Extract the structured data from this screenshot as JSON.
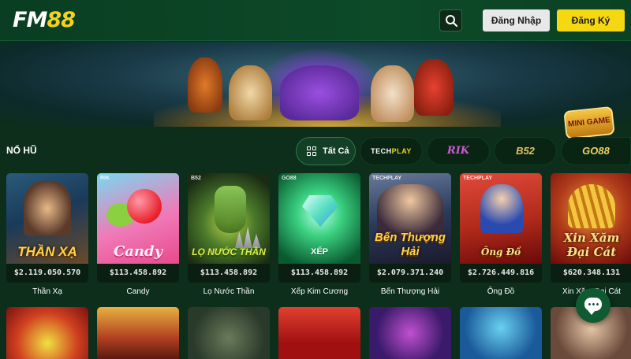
{
  "header": {
    "logo_part1": "FM",
    "logo_part2": "88",
    "login_label": "Đăng Nhập",
    "register_label": "Đăng Ký",
    "search_icon": "search-icon"
  },
  "banner": {
    "mini_game_label": "MINI GAME"
  },
  "section": {
    "title": "NỔ HŨ"
  },
  "filters": {
    "all_label": "Tất Cả",
    "techplay_part1": "TECH",
    "techplay_part2": "PLAY",
    "rik_label": "RIK",
    "b52_label": "B52",
    "go88_label": "GO88"
  },
  "games": [
    {
      "name": "Thần Xạ",
      "art_title": "THẦN XẠ",
      "prize": "$2.119.050.570"
    },
    {
      "name": "Candy",
      "art_title": "Candy",
      "prize": "$113.458.892",
      "provider": "RIK"
    },
    {
      "name": "Lọ Nước Thần",
      "art_title": "LỌ NƯỚC THẦN",
      "prize": "$113.458.892",
      "provider": "B52"
    },
    {
      "name": "Xếp Kim Cương",
      "art_title": "XẾP",
      "prize": "$113.458.892",
      "provider": "GO88"
    },
    {
      "name": "Bến Thượng Hải",
      "art_title": "Bến Thượng Hải",
      "prize": "$2.079.371.240",
      "provider": "TECHPLAY"
    },
    {
      "name": "Ông Đồ",
      "art_title": "Ông Đồ",
      "prize": "$2.726.449.816",
      "provider": "TECHPLAY"
    },
    {
      "name": "Xin Xăm Đại Cát",
      "art_title": "Xin Xăm Đại Cát",
      "prize": "$620.348.131"
    }
  ],
  "colors": {
    "brand_green": "#0c4a28",
    "accent_yellow": "#f5d712"
  }
}
